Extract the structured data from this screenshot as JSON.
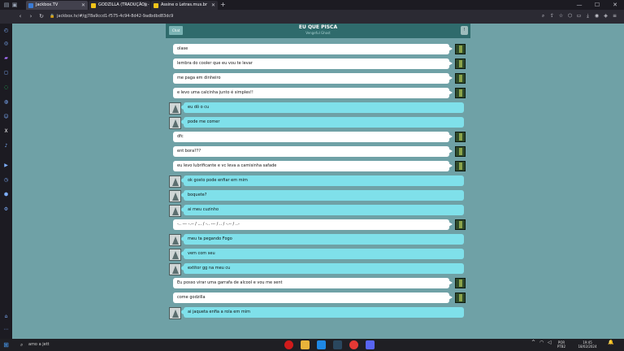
{
  "browser": {
    "tabs": [
      {
        "label": "Jackbox.TV",
        "active": true,
        "icon": "jackbox-favicon"
      },
      {
        "label": "GODZILLA (TRADUÇÃO) - ",
        "active": false,
        "icon": "lyrics-favicon"
      },
      {
        "label": "Assine o Letras.mus.br",
        "active": false,
        "icon": "lyrics-favicon"
      }
    ],
    "new_tab": "+",
    "url": "jackbox.tv/#/gj78a9ccd1-f575-4c94-8d42-9adbdbd83dc9",
    "window_controls": {
      "minimize": "—",
      "maximize": "☐",
      "close": "✕"
    }
  },
  "chat": {
    "back_label": "Chat",
    "title": "EU QUE PISCA",
    "subtitle": "Vengeful Ghost",
    "info_label": "!",
    "messages": [
      {
        "from": "me",
        "text": "olase"
      },
      {
        "from": "me",
        "text": "lembra do cooler que eu vou te levar"
      },
      {
        "from": "me",
        "text": "me paga em dinheiro"
      },
      {
        "from": "me",
        "text": "e levo uma calcinha junto é simples!!"
      },
      {
        "from": "them",
        "text": "eu dô o cu"
      },
      {
        "from": "them",
        "text": "pode me comer"
      },
      {
        "from": "me",
        "text": "dfc"
      },
      {
        "from": "me",
        "text": "ent bora???"
      },
      {
        "from": "me",
        "text": "eu levo lubrificante e vc leva a camisinha safade"
      },
      {
        "from": "them",
        "text": "ok gosto pode enfiar em mim"
      },
      {
        "from": "them",
        "text": "boquete?"
      },
      {
        "from": "them",
        "text": "ai meu cuzinho"
      },
      {
        "from": "me",
        "text": "-.. --- -.-- / ... / -.. --- / .. / -.-- / ..-"
      },
      {
        "from": "them",
        "text": "meu ta pegando Fogo"
      },
      {
        "from": "them",
        "text": "vem com seu"
      },
      {
        "from": "them",
        "text": "extitor gg na meu cu"
      },
      {
        "from": "me",
        "text": "Eu posso virar uma garrafa de alcool e vou me sent"
      },
      {
        "from": "me",
        "text": "come godzilla"
      },
      {
        "from": "them",
        "text": "ai jaqueta enfia a rola em mim"
      }
    ]
  },
  "taskbar": {
    "search_placeholder": "amo a jett",
    "lang_top": "POR",
    "lang_bottom": "PTB2",
    "time": "19:45",
    "date": "18/02/2024"
  },
  "colors": {
    "page_bg": "#6fa1a6",
    "header_bg": "#2f6b6c",
    "my_bubble": "#ffffff",
    "their_bubble": "#7fe0ea"
  }
}
